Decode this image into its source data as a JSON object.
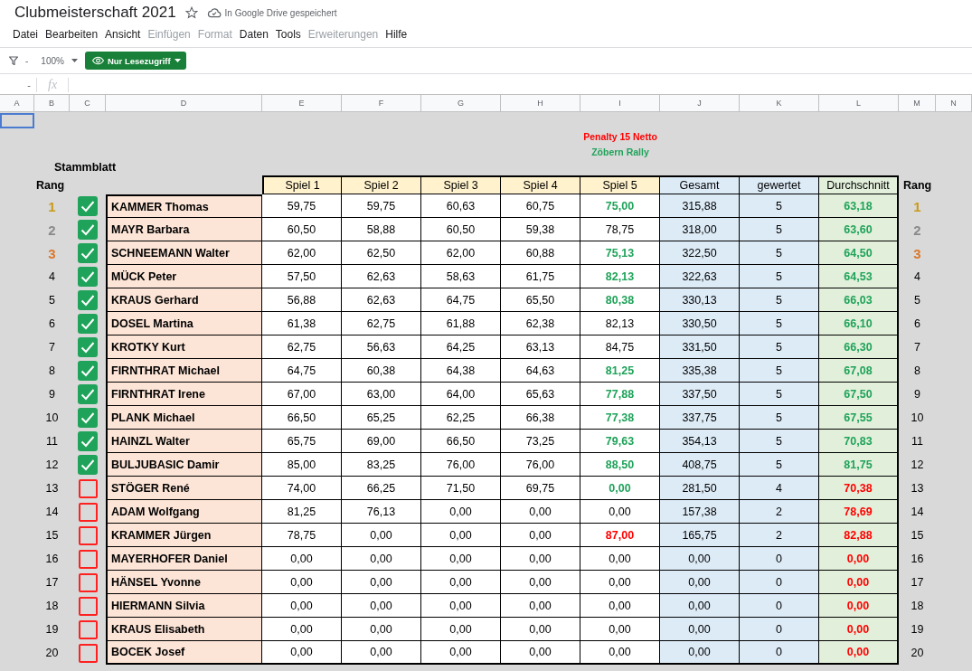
{
  "document": {
    "title": "Clubmeisterschaft 2021",
    "save_status": "In Google Drive gespeichert"
  },
  "menu": [
    {
      "label": "Datei",
      "disabled": false
    },
    {
      "label": "Bearbeiten",
      "disabled": false
    },
    {
      "label": "Ansicht",
      "disabled": false
    },
    {
      "label": "Einfügen",
      "disabled": true
    },
    {
      "label": "Format",
      "disabled": true
    },
    {
      "label": "Daten",
      "disabled": false
    },
    {
      "label": "Tools",
      "disabled": false
    },
    {
      "label": "Erweiterungen",
      "disabled": true
    },
    {
      "label": "Hilfe",
      "disabled": false
    }
  ],
  "toolbar": {
    "filter_text": "-",
    "zoom": "100%",
    "mode_button": "Nur Lesezugriff"
  },
  "formula_bar": {
    "name_box": "-",
    "fx_label": "fx"
  },
  "column_headers": [
    "A",
    "B",
    "C",
    "D",
    "E",
    "F",
    "G",
    "H",
    "I",
    "J",
    "K",
    "L",
    "M",
    "N"
  ],
  "sheet": {
    "notes": [
      {
        "text": "Penalty 15 Netto",
        "color": "#ff0000"
      },
      {
        "text": "Zöbern Rally",
        "color": "#1fa35a"
      }
    ],
    "section_label": "Stammblatt",
    "rank_heading_left": "Rang",
    "rank_heading_right": "Rang",
    "columns": [
      "Spiel 1",
      "Spiel 2",
      "Spiel 3",
      "Spiel 4",
      "Spiel 5",
      "Gesamt",
      "gewertet",
      "Durchschnitt"
    ],
    "rows": [
      {
        "rank": {
          "value": "1",
          "color": "#c99a1a"
        },
        "checked": true,
        "name": "KAMMER Thomas",
        "scores": [
          "59,75",
          "59,75",
          "60,63",
          "60,75"
        ],
        "last_score": {
          "value": "75,00",
          "color": "#1fa35a"
        },
        "total": "315,88",
        "counted": "5",
        "average": {
          "value": "63,18",
          "color": "#1fa35a"
        },
        "rank_right": {
          "value": "1",
          "color": "#c99a1a"
        }
      },
      {
        "rank": {
          "value": "2",
          "color": "#8a8a8a"
        },
        "checked": true,
        "name": "MAYR Barbara",
        "scores": [
          "60,50",
          "58,88",
          "60,50",
          "59,38"
        ],
        "last_score": {
          "value": "78,75",
          "color": "#000000"
        },
        "total": "318,00",
        "counted": "5",
        "average": {
          "value": "63,60",
          "color": "#1fa35a"
        },
        "rank_right": {
          "value": "2",
          "color": "#8a8a8a"
        }
      },
      {
        "rank": {
          "value": "3",
          "color": "#d9782d"
        },
        "checked": true,
        "name": "SCHNEEMANN Walter",
        "scores": [
          "62,00",
          "62,50",
          "62,00",
          "60,88"
        ],
        "last_score": {
          "value": "75,13",
          "color": "#1fa35a"
        },
        "total": "322,50",
        "counted": "5",
        "average": {
          "value": "64,50",
          "color": "#1fa35a"
        },
        "rank_right": {
          "value": "3",
          "color": "#d9782d"
        }
      },
      {
        "rank": {
          "value": "4",
          "color": "#000000"
        },
        "checked": true,
        "name": "MÜCK Peter",
        "scores": [
          "57,50",
          "62,63",
          "58,63",
          "61,75"
        ],
        "last_score": {
          "value": "82,13",
          "color": "#1fa35a"
        },
        "total": "322,63",
        "counted": "5",
        "average": {
          "value": "64,53",
          "color": "#1fa35a"
        },
        "rank_right": {
          "value": "4",
          "color": "#000000"
        }
      },
      {
        "rank": {
          "value": "5",
          "color": "#000000"
        },
        "checked": true,
        "name": "KRAUS Gerhard",
        "scores": [
          "56,88",
          "62,63",
          "64,75",
          "65,50"
        ],
        "last_score": {
          "value": "80,38",
          "color": "#1fa35a"
        },
        "total": "330,13",
        "counted": "5",
        "average": {
          "value": "66,03",
          "color": "#1fa35a"
        },
        "rank_right": {
          "value": "5",
          "color": "#000000"
        }
      },
      {
        "rank": {
          "value": "6",
          "color": "#000000"
        },
        "checked": true,
        "name": "DOSEL Martina",
        "scores": [
          "61,38",
          "62,75",
          "61,88",
          "62,38"
        ],
        "last_score": {
          "value": "82,13",
          "color": "#000000"
        },
        "total": "330,50",
        "counted": "5",
        "average": {
          "value": "66,10",
          "color": "#1fa35a"
        },
        "rank_right": {
          "value": "6",
          "color": "#000000"
        }
      },
      {
        "rank": {
          "value": "7",
          "color": "#000000"
        },
        "checked": true,
        "name": "KROTKY Kurt",
        "scores": [
          "62,75",
          "56,63",
          "64,25",
          "63,13"
        ],
        "last_score": {
          "value": "84,75",
          "color": "#000000"
        },
        "total": "331,50",
        "counted": "5",
        "average": {
          "value": "66,30",
          "color": "#1fa35a"
        },
        "rank_right": {
          "value": "7",
          "color": "#000000"
        }
      },
      {
        "rank": {
          "value": "8",
          "color": "#000000"
        },
        "checked": true,
        "name": "FIRNTHRAT Michael",
        "scores": [
          "64,75",
          "60,38",
          "64,38",
          "64,63"
        ],
        "last_score": {
          "value": "81,25",
          "color": "#1fa35a"
        },
        "total": "335,38",
        "counted": "5",
        "average": {
          "value": "67,08",
          "color": "#1fa35a"
        },
        "rank_right": {
          "value": "8",
          "color": "#000000"
        }
      },
      {
        "rank": {
          "value": "9",
          "color": "#000000"
        },
        "checked": true,
        "name": "FIRNTHRAT Irene",
        "scores": [
          "67,00",
          "63,00",
          "64,00",
          "65,63"
        ],
        "last_score": {
          "value": "77,88",
          "color": "#1fa35a"
        },
        "total": "337,50",
        "counted": "5",
        "average": {
          "value": "67,50",
          "color": "#1fa35a"
        },
        "rank_right": {
          "value": "9",
          "color": "#000000"
        }
      },
      {
        "rank": {
          "value": "10",
          "color": "#000000"
        },
        "checked": true,
        "name": "PLANK Michael",
        "scores": [
          "66,50",
          "65,25",
          "62,25",
          "66,38"
        ],
        "last_score": {
          "value": "77,38",
          "color": "#1fa35a"
        },
        "total": "337,75",
        "counted": "5",
        "average": {
          "value": "67,55",
          "color": "#1fa35a"
        },
        "rank_right": {
          "value": "10",
          "color": "#000000"
        }
      },
      {
        "rank": {
          "value": "11",
          "color": "#000000"
        },
        "checked": true,
        "name": "HAINZL Walter",
        "scores": [
          "65,75",
          "69,00",
          "66,50",
          "73,25"
        ],
        "last_score": {
          "value": "79,63",
          "color": "#1fa35a"
        },
        "total": "354,13",
        "counted": "5",
        "average": {
          "value": "70,83",
          "color": "#1fa35a"
        },
        "rank_right": {
          "value": "11",
          "color": "#000000"
        }
      },
      {
        "rank": {
          "value": "12",
          "color": "#000000"
        },
        "checked": true,
        "name": "BULJUBASIC Damir",
        "scores": [
          "85,00",
          "83,25",
          "76,00",
          "76,00"
        ],
        "last_score": {
          "value": "88,50",
          "color": "#1fa35a"
        },
        "total": "408,75",
        "counted": "5",
        "average": {
          "value": "81,75",
          "color": "#1fa35a"
        },
        "rank_right": {
          "value": "12",
          "color": "#000000"
        }
      },
      {
        "rank": {
          "value": "13",
          "color": "#000000"
        },
        "checked": false,
        "name": "STÖGER René",
        "scores": [
          "74,00",
          "66,25",
          "71,50",
          "69,75"
        ],
        "last_score": {
          "value": "0,00",
          "color": "#1fa35a"
        },
        "total": "281,50",
        "counted": "4",
        "average": {
          "value": "70,38",
          "color": "#ff0000"
        },
        "rank_right": {
          "value": "13",
          "color": "#000000"
        }
      },
      {
        "rank": {
          "value": "14",
          "color": "#000000"
        },
        "checked": false,
        "name": "ADAM Wolfgang",
        "scores": [
          "81,25",
          "76,13",
          "0,00",
          "0,00"
        ],
        "last_score": {
          "value": "0,00",
          "color": "#000000"
        },
        "total": "157,38",
        "counted": "2",
        "average": {
          "value": "78,69",
          "color": "#ff0000"
        },
        "rank_right": {
          "value": "14",
          "color": "#000000"
        }
      },
      {
        "rank": {
          "value": "15",
          "color": "#000000"
        },
        "checked": false,
        "name": "KRAMMER Jürgen",
        "scores": [
          "78,75",
          "0,00",
          "0,00",
          "0,00"
        ],
        "last_score": {
          "value": "87,00",
          "color": "#ff0000"
        },
        "total": "165,75",
        "counted": "2",
        "average": {
          "value": "82,88",
          "color": "#ff0000"
        },
        "rank_right": {
          "value": "15",
          "color": "#000000"
        }
      },
      {
        "rank": {
          "value": "16",
          "color": "#000000"
        },
        "checked": false,
        "name": "MAYERHOFER Daniel",
        "scores": [
          "0,00",
          "0,00",
          "0,00",
          "0,00"
        ],
        "last_score": {
          "value": "0,00",
          "color": "#000000"
        },
        "total": "0,00",
        "counted": "0",
        "average": {
          "value": "0,00",
          "color": "#ff0000"
        },
        "rank_right": {
          "value": "16",
          "color": "#000000"
        }
      },
      {
        "rank": {
          "value": "17",
          "color": "#000000"
        },
        "checked": false,
        "name": "HÄNSEL Yvonne",
        "scores": [
          "0,00",
          "0,00",
          "0,00",
          "0,00"
        ],
        "last_score": {
          "value": "0,00",
          "color": "#000000"
        },
        "total": "0,00",
        "counted": "0",
        "average": {
          "value": "0,00",
          "color": "#ff0000"
        },
        "rank_right": {
          "value": "17",
          "color": "#000000"
        }
      },
      {
        "rank": {
          "value": "18",
          "color": "#000000"
        },
        "checked": false,
        "name": "HIERMANN Silvia",
        "scores": [
          "0,00",
          "0,00",
          "0,00",
          "0,00"
        ],
        "last_score": {
          "value": "0,00",
          "color": "#000000"
        },
        "total": "0,00",
        "counted": "0",
        "average": {
          "value": "0,00",
          "color": "#ff0000"
        },
        "rank_right": {
          "value": "18",
          "color": "#000000"
        }
      },
      {
        "rank": {
          "value": "19",
          "color": "#000000"
        },
        "checked": false,
        "name": "KRAUS Elisabeth",
        "scores": [
          "0,00",
          "0,00",
          "0,00",
          "0,00"
        ],
        "last_score": {
          "value": "0,00",
          "color": "#000000"
        },
        "total": "0,00",
        "counted": "0",
        "average": {
          "value": "0,00",
          "color": "#ff0000"
        },
        "rank_right": {
          "value": "19",
          "color": "#000000"
        }
      },
      {
        "rank": {
          "value": "20",
          "color": "#000000"
        },
        "checked": false,
        "name": "BOCEK Josef",
        "scores": [
          "0,00",
          "0,00",
          "0,00",
          "0,00"
        ],
        "last_score": {
          "value": "0,00",
          "color": "#000000"
        },
        "total": "0,00",
        "counted": "0",
        "average": {
          "value": "0,00",
          "color": "#ff0000"
        },
        "rank_right": {
          "value": "20",
          "color": "#000000"
        }
      }
    ]
  }
}
